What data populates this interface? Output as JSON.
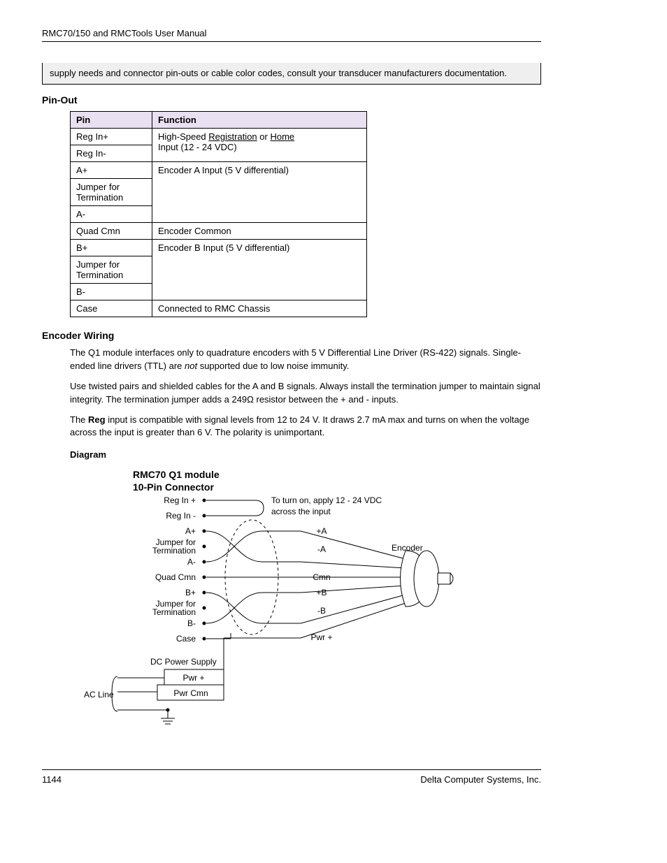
{
  "header": {
    "title": "RMC70/150 and RMCTools User Manual"
  },
  "notebox": {
    "text": "supply needs and connector pin-outs or cable color codes, consult your transducer manufacturers documentation."
  },
  "pinout": {
    "heading": "Pin-Out",
    "columns": {
      "pin": "Pin",
      "function": "Function"
    },
    "rows": [
      {
        "pin": "Reg In+",
        "func_line1": "High-Speed ",
        "func_underline1": "Registration",
        "func_mid": " or ",
        "func_underline2": "Home",
        "rowspan": 2,
        "func_line2": "Input (12 - 24 VDC)"
      },
      {
        "pin": "Reg In-"
      },
      {
        "pin": "A+",
        "func": "Encoder A Input (5 V differential)",
        "rowspan": 3
      },
      {
        "pin": "Jumper for Termination"
      },
      {
        "pin": "A-"
      },
      {
        "pin": "Quad Cmn",
        "func": "Encoder Common",
        "rowspan": 1
      },
      {
        "pin": "B+",
        "func": "Encoder B Input (5 V differential)",
        "rowspan": 3
      },
      {
        "pin": "Jumper for Termination"
      },
      {
        "pin": "B-"
      },
      {
        "pin": "Case",
        "func": "Connected to RMC Chassis",
        "rowspan": 1
      }
    ]
  },
  "encoder": {
    "heading": "Encoder Wiring",
    "p1a": "The Q1 module interfaces only to quadrature encoders with 5 V Differential Line Driver (RS-422) signals. Single-ended line drivers (TTL) are ",
    "p1i": "not",
    "p1b": " supported due to low noise immunity.",
    "p2": "Use twisted pairs and shielded cables for the A and B signals. Always install the termination jumper to maintain signal integrity. The termination jumper adds a 249Ω resistor between the + and - inputs.",
    "p3a": "The ",
    "p3bold": "Reg",
    "p3b": " input is compatible with signal levels from 12 to 24 V. It draws 2.7 mA max and turns on when the voltage across the input is greater than 6 V. The polarity is unimportant."
  },
  "diagram": {
    "heading": "Diagram",
    "title1": "RMC70 Q1 module",
    "title2": "10-Pin Connector",
    "pins": [
      "Reg In +",
      "Reg In -",
      "A+",
      "Jumper for",
      "Termination",
      "A-",
      "Quad Cmn",
      "B+",
      "Jumper for",
      "Termination",
      "B-",
      "Case"
    ],
    "note1": "To turn on, apply 12 - 24 VDC",
    "note2": "across the input",
    "enc": {
      "aPlus": "+A",
      "aMinus": "-A",
      "cmn": "Cmn",
      "bPlus": "+B",
      "bMinus": "-B",
      "pwr": "Pwr +",
      "label": "Encoder"
    },
    "dc": {
      "label": "DC Power Supply",
      "pwrp": "Pwr +",
      "pwrc": "Pwr Cmn"
    },
    "ac": "AC Line"
  },
  "footer": {
    "page": "1144",
    "company": "Delta Computer Systems, Inc."
  }
}
